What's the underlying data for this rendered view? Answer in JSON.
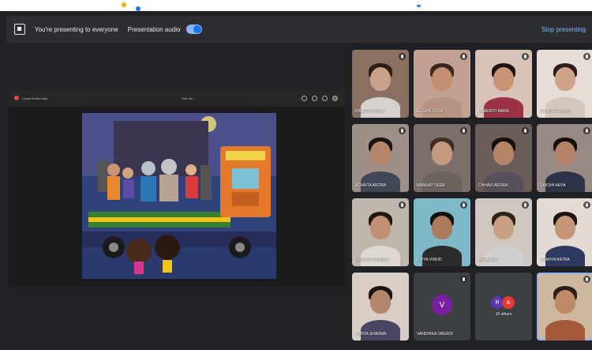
{
  "topbar": {
    "presenting_text": "You're presenting to everyone",
    "audio_label": "Presentation audio",
    "audio_on": true,
    "stop_label": "Stop presenting"
  },
  "shared_tab": {
    "title": "Crazy Gaida Lady",
    "center_text": "Sub-tab"
  },
  "participants": [
    {
      "name": "PRACHI YADAV",
      "bg": "#8a6f62",
      "skin": "#c9a18a",
      "hair": "#2a1d18",
      "body": "#d6d0cf"
    },
    {
      "name": "ELISHA JOSHI",
      "bg": "#c2a193",
      "skin": "#c48e70",
      "hair": "#3a271c",
      "body": "#b79382"
    },
    {
      "name": "PRAKRITI BAWA",
      "bg": "#d7c3b8",
      "skin": "#c99476",
      "hair": "#1b1410",
      "body": "#9c3245"
    },
    {
      "name": "VAIBHAVI SHAH",
      "bg": "#e6ded6",
      "skin": "#d0a48a",
      "hair": "#2a1f1a",
      "body": "#d5c6bc"
    },
    {
      "name": "ADVAITA ARORA",
      "bg": "#9e8f88",
      "skin": "#b6866a",
      "hair": "#181210",
      "body": "#404756"
    },
    {
      "name": "MANNAT VEER",
      "bg": "#7a6f6a",
      "skin": "#c39a7e",
      "hair": "#3c2f26",
      "body": "#6b625d"
    },
    {
      "name": "CHHAVI ARORA",
      "bg": "#6a5c57",
      "skin": "#b58568",
      "hair": "#15100e",
      "body": "#58505a"
    },
    {
      "name": "SAKSHI ARYA",
      "bg": "#978a85",
      "skin": "#b38264",
      "hair": "#14100d",
      "body": "#2e3247"
    },
    {
      "name": "LAVANYA MISHRA",
      "bg": "#bfb6ae",
      "skin": "#c29173",
      "hair": "#1e1714",
      "body": "#ded8d2"
    },
    {
      "name": "DIVYA VINOD",
      "bg": "#7fb8c7",
      "skin": "#ad7a5e",
      "hair": "#101010",
      "body": "#2b2b2b"
    },
    {
      "name": "MIRA JAIN",
      "bg": "#cfc7c0",
      "skin": "#caa084",
      "hair": "#2d231d",
      "body": "#cfcfcf"
    },
    {
      "name": "ANANYA BATRA",
      "bg": "#e4dcd4",
      "skin": "#c69578",
      "hair": "#1a1412",
      "body": "#2d3a60"
    },
    {
      "name": "ANNYA SHARMA",
      "bg": "#d8cec6",
      "skin": "#b5866b",
      "hair": "#1b1512",
      "body": "#4b4463"
    }
  ],
  "avatar_tile": {
    "name": "VANDHIKA OBEROI",
    "initial": "V"
  },
  "others_tile": {
    "label": "10 others",
    "initials": [
      "R",
      "A"
    ]
  },
  "self_tile": {
    "name": ""
  }
}
